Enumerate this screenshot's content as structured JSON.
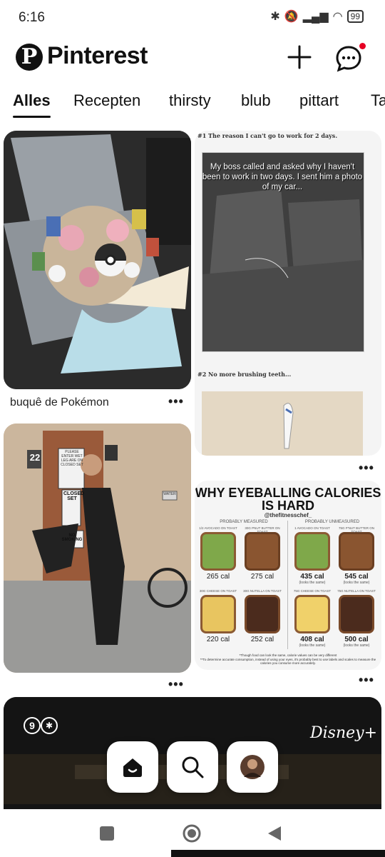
{
  "status": {
    "time": "6:16",
    "battery": "99"
  },
  "header": {
    "brand": "Pinterest",
    "logo_letter": "P"
  },
  "tabs": [
    {
      "label": "Alles"
    },
    {
      "label": "Recepten"
    },
    {
      "label": "thirsty"
    },
    {
      "label": "blub"
    },
    {
      "label": "pittart"
    },
    {
      "label": "Ta"
    }
  ],
  "pins": {
    "bouquet": {
      "caption": "buquê de Pokémon"
    },
    "meme": {
      "line1": "#1 The reason I can't go to work for 2 days.",
      "bubble": "My boss called and asked why I haven't been to work in two days.  I sent him a photo of my car...",
      "line2": "#2 No more brushing teeth..."
    },
    "person": {
      "sign_stage": "22",
      "sign_please": "PLEASE ENTER WET LEG ARE ON CLOSED SET",
      "sign_closed": "CLOSED SET",
      "sign_no_smoking": "NO SMOKING",
      "sign_water": "WATER"
    },
    "calories": {
      "title": "WHY EYEBALLING CALORIES IS HARD",
      "handle": "@thefitnesschef_",
      "left_head": "PROBABLY MEASURED",
      "right_head": "PROBABLY UNMEASURED",
      "items": [
        {
          "label": "1/2 AVOCADO ON TOAST",
          "cal": "265 cal",
          "note": ""
        },
        {
          "label": "30G PNUT BUTTER ON TOAST",
          "cal": "275 cal",
          "note": ""
        },
        {
          "label": "1 AVOCADO ON TOAST",
          "cal": "435 cal",
          "note": "(looks the same)"
        },
        {
          "label": "75G P'NUT BUTTER ON TOAST",
          "cal": "545 cal",
          "note": "(looks the same)"
        },
        {
          "label": "30G CHEESE ON TOAST",
          "cal": "220 cal",
          "note": ""
        },
        {
          "label": "30G NUTELLA ON TOAST",
          "cal": "252 cal",
          "note": ""
        },
        {
          "label": "75G CHEESE ON TOAST",
          "cal": "408 cal",
          "note": "(looks the same)"
        },
        {
          "label": "75G NUTELLA ON TOAST",
          "cal": "500 cal",
          "note": "(looks the same)"
        }
      ],
      "foot1": "*Though food can look the same, calorie values can be very different",
      "foot2": "**To determine accurate consumption, instead of using your eyes, it's probably best to use labels and scales to measure the calories you consume more accurately."
    },
    "ad": {
      "rating": "9",
      "brand": "Disney+"
    }
  },
  "icons": {
    "home": "home-icon",
    "search": "search-icon",
    "profile": "profile-avatar",
    "add": "plus-icon",
    "messages": "chat-icon"
  },
  "colors": {
    "brand_red": "#e60023",
    "text": "#111111"
  }
}
